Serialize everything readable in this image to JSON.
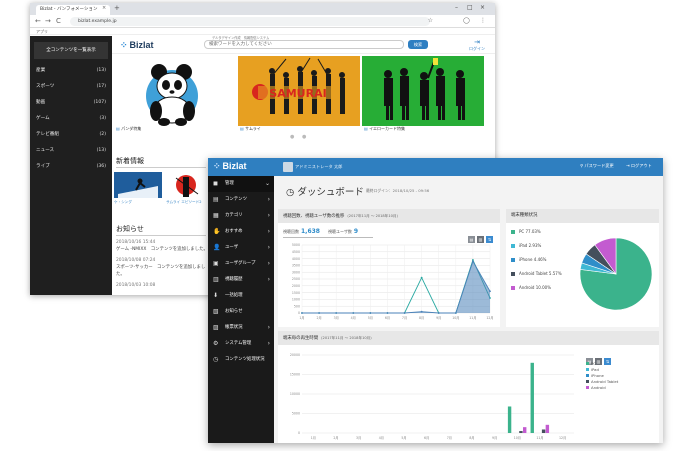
{
  "back_browser": {
    "tab_title": "Bizlat - バンフォメーション",
    "tab_close": "×",
    "new_tab": "+",
    "win_min": "–",
    "win_max": "□",
    "win_close": "×",
    "nav": {
      "back": "←",
      "forward": "→",
      "reload": "C"
    },
    "address": "bizlat.example.jp",
    "bookmarks": "アプリ",
    "sidebar_header": "全コンテンツを一覧表示",
    "categories": [
      {
        "label": "産業",
        "count": "(13)"
      },
      {
        "label": "スポーツ",
        "count": "(17)"
      },
      {
        "label": "動画",
        "count": "(107)"
      },
      {
        "label": "ゲーム",
        "count": "(3)"
      },
      {
        "label": "テレビ番組",
        "count": "(2)"
      },
      {
        "label": "ニュース",
        "count": "(13)"
      },
      {
        "label": "ライブ",
        "count": "(36)"
      }
    ],
    "top_notice": "デルタデザイン作成　情報配信システム",
    "brand": "Bizlat",
    "search_placeholder": "検索ワードを入力してください",
    "search_button": "検索",
    "login_label": "ログイン",
    "banner_captions": [
      "パンダ特集",
      "サムライ",
      "イエローカード特集"
    ],
    "samurai_text": "SAMURAI",
    "dots": "● ●",
    "new_section_title": "新着情報",
    "new_captions": [
      "ケ・シング",
      "サムライ エピソード2"
    ],
    "notice_title": "お知らせ",
    "notices": [
      {
        "date": "2018/10/16 15:44",
        "text": "ゲーム -NMIXX　コンテンツを追加しました。"
      },
      {
        "date": "2018/10/08 07:24",
        "text": "スポーツ-サッカー　コンテンツを追加しました。"
      },
      {
        "date": "2018/10/03 10:08",
        "text": ""
      }
    ]
  },
  "dashboard": {
    "brand": "Bizlat",
    "user_name": "アドミニストレータ 太郎",
    "password_link": "パスワード変更",
    "logout_link": "ログアウト",
    "menu": [
      {
        "label": "管理",
        "icon": "◼",
        "chev": "⌄",
        "active": true
      },
      {
        "label": "コンテンツ",
        "icon": "▤",
        "chev": "›"
      },
      {
        "label": "カテゴリ",
        "icon": "▦",
        "chev": "›"
      },
      {
        "label": "おすすめ",
        "icon": "✋",
        "chev": "›"
      },
      {
        "label": "ユーザ",
        "icon": "👤",
        "chev": "›"
      },
      {
        "label": "ユーザグループ",
        "icon": "▣",
        "chev": "›"
      },
      {
        "label": "視聴履歴",
        "icon": "▥",
        "chev": "›"
      },
      {
        "label": "一括処理",
        "icon": "⬇",
        "chev": ""
      },
      {
        "label": "お知らせ",
        "icon": "▧",
        "chev": ""
      },
      {
        "label": "帳票状況",
        "icon": "▨",
        "chev": "›"
      },
      {
        "label": "システム管理",
        "icon": "⚙",
        "chev": "›"
      },
      {
        "label": "コンテンツ処理状況",
        "icon": "◷",
        "chev": ""
      }
    ],
    "title": "ダッシュボード",
    "title_icon": "◷",
    "last_login": "最終ログイン：2018/10/25 - 09:56",
    "panel_views": {
      "title": "視聴回数、視聴ユーザ数の推移",
      "range": "(2017年11月 ～ 2018年10月)",
      "stat1_label": "視聴回数",
      "stat1_value": "1,638",
      "stat2_label": "視聴ユーザ数",
      "stat2_value": "9"
    },
    "panel_device": {
      "title": "端末種類状況"
    },
    "panel_playtime": {
      "title": "端末毎の再生時間",
      "range": "(2017年11月 ～ 2018年10月)"
    },
    "icon_buttons": [
      "▤",
      "▥",
      "⇅"
    ]
  },
  "chart_data": [
    {
      "type": "line",
      "title": "視聴回数、視聴ユーザ数の推移",
      "x": [
        "1月",
        "2月",
        "3月",
        "4月",
        "5月",
        "6月",
        "7月",
        "8月",
        "9月",
        "10月",
        "11月",
        "12月"
      ],
      "ylim": [
        0,
        5000
      ],
      "yticks": [
        "5000",
        "4500",
        "4000",
        "3500",
        "3000",
        "2500",
        "2000",
        "1500",
        "1000",
        "500",
        "0"
      ],
      "series": [
        {
          "values": [
            0,
            0,
            0,
            0,
            0,
            0,
            0,
            2600,
            0,
            0,
            3900,
            1100
          ],
          "color": "#2aa9a2"
        },
        {
          "values": [
            0,
            0,
            0,
            0,
            0,
            0,
            0,
            100,
            0,
            0,
            3800,
            1600
          ],
          "color": "#4a82b8",
          "area": true
        }
      ],
      "grid": true
    },
    {
      "type": "pie",
      "title": "端末種類状況",
      "series": [
        {
          "name": "PC",
          "value": 77.03,
          "label": "PC 77.03%",
          "color": "#3bb38c"
        },
        {
          "name": "iPad",
          "value": 2.93,
          "label": "iPad 2.93%",
          "color": "#3fb8d4"
        },
        {
          "name": "iPhone",
          "value": 4.46,
          "label": "iPhone 4.46%",
          "color": "#2f8ec9"
        },
        {
          "name": "Android Tablet",
          "value": 5.57,
          "label": "Android Tablet 5.57%",
          "color": "#444f5c"
        },
        {
          "name": "Android",
          "value": 10.0,
          "label": "Android 10.00%",
          "color": "#c35bd0"
        }
      ]
    },
    {
      "type": "bar",
      "title": "端末毎の再生時間",
      "x": [
        "1月",
        "2月",
        "3月",
        "4月",
        "5月",
        "6月",
        "7月",
        "8月",
        "9月",
        "10月",
        "11月",
        "12月"
      ],
      "ylim": [
        0,
        20000
      ],
      "yticks": [
        "20000",
        "15000",
        "10000",
        "5000",
        "0"
      ],
      "series": [
        {
          "name": "PC",
          "values": [
            0,
            0,
            0,
            0,
            0,
            0,
            0,
            0,
            0,
            6800,
            18000,
            0
          ],
          "color": "#3bb38c"
        },
        {
          "name": "iPad",
          "values": [
            0,
            0,
            0,
            0,
            0,
            0,
            0,
            0,
            0,
            0,
            0,
            0
          ],
          "color": "#3fb8d4"
        },
        {
          "name": "iPhone",
          "values": [
            0,
            0,
            0,
            0,
            0,
            0,
            0,
            0,
            0,
            0,
            0,
            0
          ],
          "color": "#2f8ec9"
        },
        {
          "name": "Android Tablet",
          "values": [
            0,
            0,
            0,
            0,
            0,
            0,
            0,
            0,
            0,
            500,
            900,
            0
          ],
          "color": "#444f5c"
        },
        {
          "name": "Android",
          "values": [
            0,
            0,
            0,
            0,
            0,
            0,
            0,
            0,
            0,
            1500,
            2100,
            0
          ],
          "color": "#c35bd0"
        }
      ],
      "grid": true
    }
  ]
}
